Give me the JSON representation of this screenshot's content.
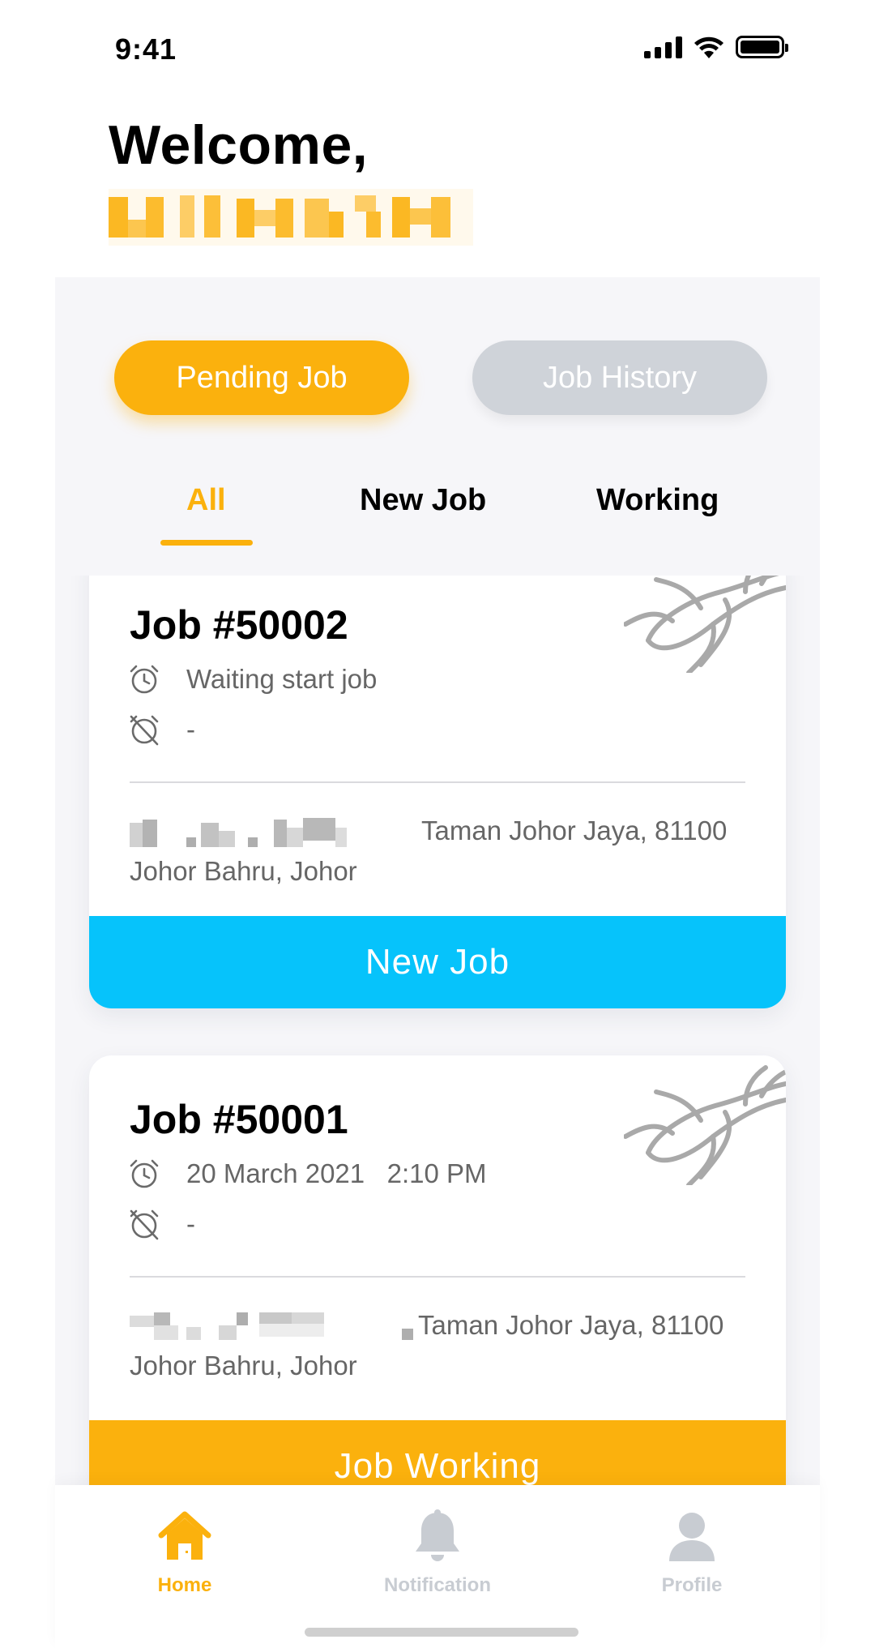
{
  "status_bar": {
    "time": "9:41"
  },
  "header": {
    "greeting": "Welcome,"
  },
  "segments": {
    "pending": "Pending Job",
    "history": "Job History"
  },
  "tabs": [
    {
      "label": "All",
      "active": true
    },
    {
      "label": "New Job",
      "active": false
    },
    {
      "label": "Working",
      "active": false
    }
  ],
  "jobs": [
    {
      "title": "Job #50002",
      "start": "Waiting start job",
      "end": "-",
      "address_line1": "Taman Johor Jaya, 81100",
      "address_line2": "Johor Bahru, Johor",
      "action": "New Job",
      "action_color": "#06c3fb"
    },
    {
      "title": "Job #50001",
      "start": "20 March 2021   2:10 PM",
      "end": "-",
      "address_line1": "Taman Johor Jaya, 81100",
      "address_line2": "Johor Bahru, Johor",
      "action": "Job Working",
      "action_color": "#fbb10d"
    }
  ],
  "nav": [
    {
      "label": "Home",
      "icon": "home-icon",
      "active": true
    },
    {
      "label": "Notification",
      "icon": "bell-icon",
      "active": false
    },
    {
      "label": "Profile",
      "icon": "user-icon",
      "active": false
    }
  ],
  "colors": {
    "accent": "#fbb10d",
    "new_job": "#06c3fb",
    "inactive": "#cfd3d9",
    "panel": "#f6f6f9"
  }
}
